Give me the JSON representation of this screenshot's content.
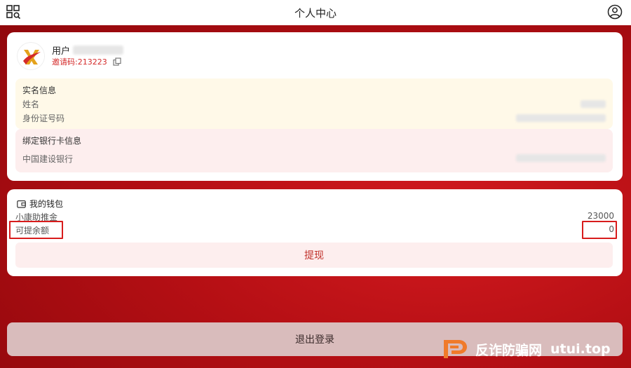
{
  "header": {
    "title": "个人中心",
    "left_icon": "scan-grid-icon",
    "right_icon": "user-circle-icon"
  },
  "profile": {
    "username_prefix": "用户",
    "invite_code": "邀请码:213223",
    "avatar_icon": "brand-logo-avatar"
  },
  "realname": {
    "heading": "实名信息",
    "name_label": "姓名",
    "id_label": "身份证号码"
  },
  "bank": {
    "heading": "绑定银行卡信息",
    "bank_name": "中国建设银行"
  },
  "wallet": {
    "heading": "我的钱包",
    "fund_label": "小康助推金",
    "fund_value": "23000",
    "withdrawable_label": "可提余额",
    "withdrawable_value": "0",
    "withdraw_button": "提现"
  },
  "logout_button": "退出登录",
  "watermark": {
    "text": "反诈防骗网",
    "domain": "utui.top"
  },
  "colors": {
    "background": "#b50f14",
    "accent_red": "#d81c1c",
    "realname_panel": "#fff9e8",
    "bank_panel": "#fdeeee",
    "watermark_logo": "#f07a2a"
  }
}
